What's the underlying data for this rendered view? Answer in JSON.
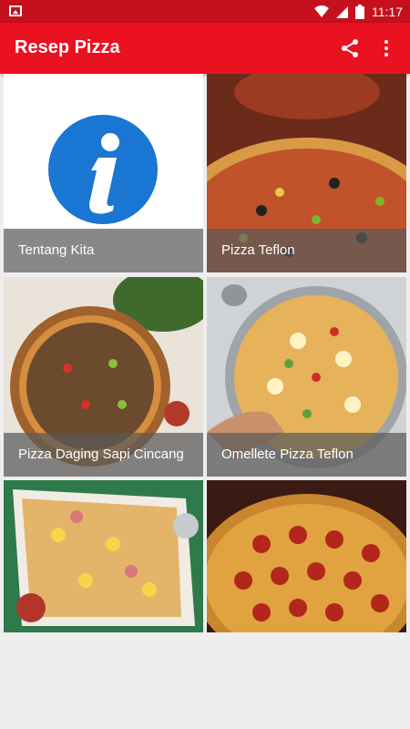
{
  "status_bar": {
    "time": "11:17",
    "battery_level": "2"
  },
  "app_bar": {
    "title": "Resep Pizza",
    "share_icon": "share-icon",
    "more_icon": "more-vert-icon"
  },
  "tiles": [
    {
      "label": "Tentang Kita",
      "image": "info-icon"
    },
    {
      "label": "Pizza Teflon",
      "image": "pizza-photo"
    },
    {
      "label": "Pizza Daging Sapi Cincang",
      "image": "pizza-photo"
    },
    {
      "label": "Omellete Pizza Teflon",
      "image": "pizza-photo"
    },
    {
      "label": "",
      "image": "pizza-photo"
    },
    {
      "label": "",
      "image": "pizza-photo"
    }
  ],
  "colors": {
    "status_bar": "#c6101d",
    "app_bar": "#ea1120",
    "info_blue": "#1976d2"
  }
}
